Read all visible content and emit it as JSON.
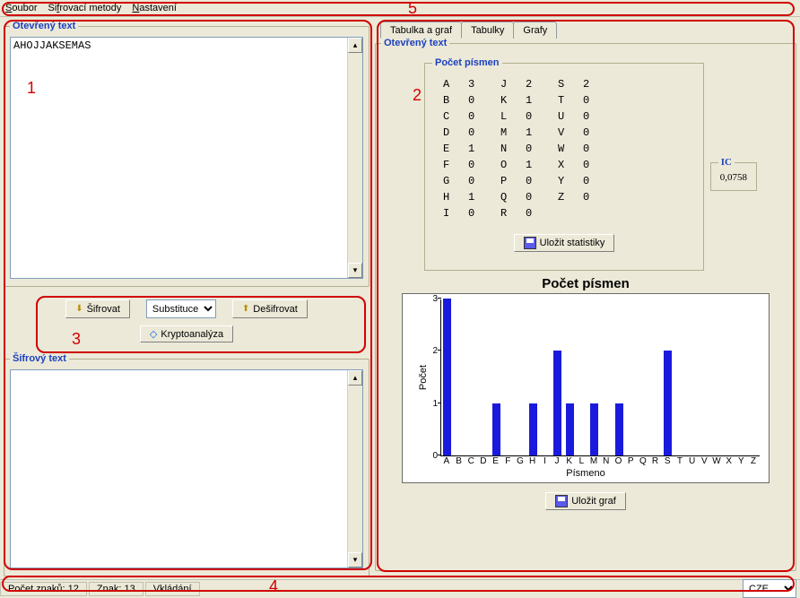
{
  "menu": {
    "file": "Soubor",
    "methods": "Šifrovací metody",
    "settings": "Nastavení"
  },
  "left": {
    "open_legend": "Otevřený text",
    "open_value": "AHOJJAKSEMAS",
    "cipher_legend": "Šifrový text",
    "cipher_value": ""
  },
  "controls": {
    "encrypt": "Šifrovat",
    "decrypt": "Dešifrovat",
    "method_selected": "Substituce",
    "crypto": "Kryptoanalýza"
  },
  "tabs": {
    "t1": "Tabulka a graf",
    "t2": "Tabulky",
    "t3": "Grafy"
  },
  "right": {
    "open_legend": "Otevřený text",
    "letters_legend": "Počet písmen",
    "ic_legend": "IC",
    "ic_value": "0,0758",
    "save_stats": "Uložit statistiky",
    "save_chart": "Uložit graf"
  },
  "counts": {
    "A": "3",
    "B": "0",
    "C": "0",
    "D": "0",
    "E": "1",
    "F": "0",
    "G": "0",
    "H": "1",
    "I": "0",
    "J": "2",
    "K": "1",
    "L": "0",
    "M": "1",
    "N": "0",
    "O": "1",
    "P": "0",
    "Q": "0",
    "R": "0",
    "S": "2",
    "T": "0",
    "U": "0",
    "V": "0",
    "W": "0",
    "X": "0",
    "Y": "0",
    "Z": "0"
  },
  "chart_data": {
    "type": "bar",
    "title": "Počet písmen",
    "xlabel": "Písmeno",
    "ylabel": "Počet",
    "ylim": [
      0,
      3
    ],
    "categories": [
      "A",
      "B",
      "C",
      "D",
      "E",
      "F",
      "G",
      "H",
      "I",
      "J",
      "K",
      "L",
      "M",
      "N",
      "O",
      "P",
      "Q",
      "R",
      "S",
      "T",
      "U",
      "V",
      "W",
      "X",
      "Y",
      "Z"
    ],
    "values": [
      3,
      0,
      0,
      0,
      1,
      0,
      0,
      1,
      0,
      2,
      1,
      0,
      1,
      0,
      1,
      0,
      0,
      0,
      2,
      0,
      0,
      0,
      0,
      0,
      0,
      0
    ]
  },
  "status": {
    "chars_label": "Počet znaků:",
    "chars_value": "12",
    "char_label": "Znak:",
    "char_value": "13",
    "mode": "Vkládání",
    "lang": "CZE"
  },
  "annotations": {
    "n1": "1",
    "n2": "2",
    "n3": "3",
    "n4": "4",
    "n5": "5"
  }
}
